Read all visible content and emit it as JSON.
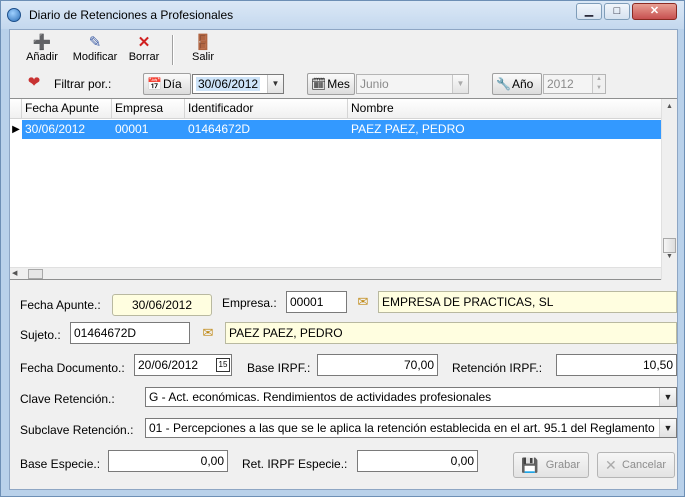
{
  "window": {
    "title": "Diario de Retenciones a Profesionales"
  },
  "titlebar_buttons": {
    "minimize": "▁",
    "maximize": "□",
    "close": "✕"
  },
  "toolbar": {
    "add_label": "Añadir",
    "modify_label": "Modificar",
    "delete_label": "Borrar",
    "exit_label": "Salir"
  },
  "filter": {
    "label": "Filtrar por.:",
    "day_button": "Día",
    "day_value": "30/06/2012",
    "month_button": "Mes",
    "month_value": "Junio",
    "year_button": "Año",
    "year_value": "2012"
  },
  "grid": {
    "columns": [
      "Fecha Apunte",
      "Empresa",
      "Identificador",
      "Nombre"
    ],
    "rows": [
      [
        "30/06/2012",
        "00001",
        "01464672D",
        "PAEZ PAEZ, PEDRO"
      ]
    ]
  },
  "form": {
    "fecha_apunte_label": "Fecha Apunte.:",
    "fecha_apunte_value": "30/06/2012",
    "empresa_label": "Empresa.:",
    "empresa_code": "00001",
    "empresa_name": "EMPRESA DE PRACTICAS, SL",
    "sujeto_label": "Sujeto.:",
    "sujeto_code": "01464672D",
    "sujeto_name": "PAEZ PAEZ, PEDRO",
    "fecha_documento_label": "Fecha Documento.:",
    "fecha_documento_value": "20/06/2012",
    "base_irpf_label": "Base IRPF.:",
    "base_irpf_value": "70,00",
    "retencion_irpf_label": "Retención IRPF.:",
    "retencion_irpf_value": "10,50",
    "clave_label": "Clave Retención.:",
    "clave_value": "G - Act. económicas. Rendimientos de actividades profesionales",
    "subclave_label": "Subclave Retención.:",
    "subclave_value": "01 - Percepciones a las que se le aplica la retención establecida en el art. 95.1 del Reglamento",
    "base_especie_label": "Base Especie.:",
    "base_especie_value": "0,00",
    "ret_irpf_especie_label": "Ret. IRPF Especie.:",
    "ret_irpf_especie_value": "0,00"
  },
  "actions": {
    "save_label": "Grabar",
    "cancel_label": "Cancelar"
  },
  "colors": {
    "selection": "#3399ff",
    "readonly_field": "#fffee0",
    "window_frame": "#b9d1ea"
  }
}
